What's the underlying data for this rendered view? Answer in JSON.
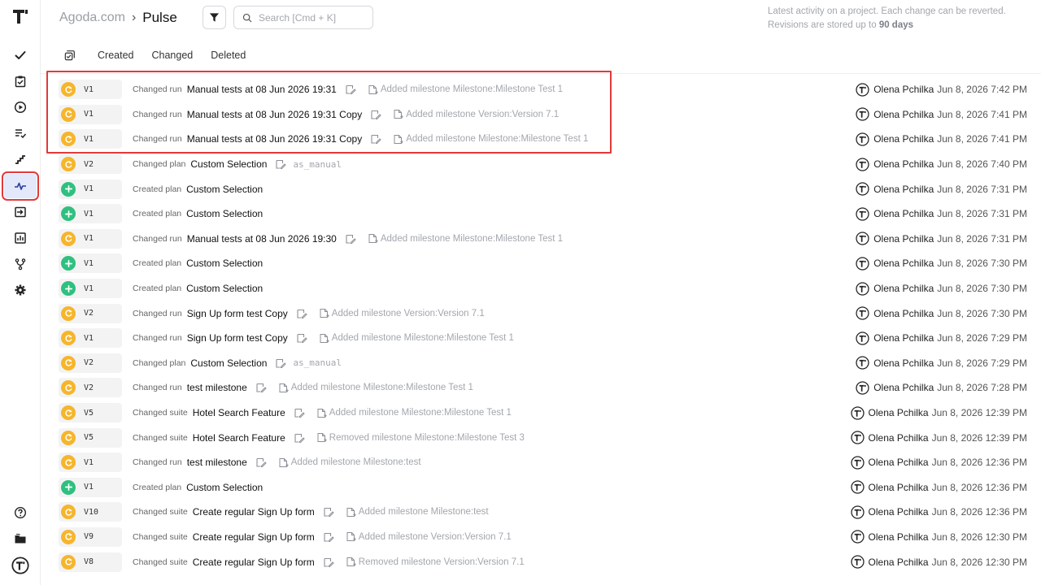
{
  "header": {
    "project": "Agoda.com",
    "separator": "›",
    "page": "Pulse",
    "note_line1": "Latest activity on a project. Each change can be reverted.",
    "note_line2_prefix": "Revisions are stored up to",
    "note_line2_bold": "90 days"
  },
  "search": {
    "placeholder": "Search [Cmd + K]"
  },
  "tabs": [
    {
      "label": "Created"
    },
    {
      "label": "Changed"
    },
    {
      "label": "Deleted"
    }
  ],
  "sidebar": {
    "items": [
      {
        "icon": "check-icon"
      },
      {
        "icon": "clipboard-check-icon"
      },
      {
        "icon": "play-circle-icon"
      },
      {
        "icon": "list-check-icon"
      },
      {
        "icon": "trend-line-icon"
      },
      {
        "icon": "pulse-icon",
        "active": true
      },
      {
        "icon": "import-icon"
      },
      {
        "icon": "bar-chart-icon"
      },
      {
        "icon": "branch-icon"
      },
      {
        "icon": "gear-icon"
      }
    ],
    "bottom": [
      {
        "icon": "help-icon"
      },
      {
        "icon": "folder-icon"
      },
      {
        "icon": "user-avatar-icon"
      }
    ]
  },
  "colors": {
    "changed": "#f6b52b",
    "created": "#2fc07f",
    "highlight": "#e23a3a",
    "active_nav": "#e3e9fb"
  },
  "rows": [
    {
      "status": "changed",
      "version": "V1",
      "action": "Changed run",
      "entity": "Manual tests at 08 Jun 2026 19:31",
      "detail": "Added milestone Milestone:Milestone Test 1",
      "mono": false,
      "author": "Olena Pchilka",
      "time": "Jun 8, 2026 7:42 PM"
    },
    {
      "status": "changed",
      "version": "V1",
      "action": "Changed run",
      "entity": "Manual tests at 08 Jun 2026 19:31 Copy",
      "detail": "Added milestone Version:Version 7.1",
      "mono": false,
      "author": "Olena Pchilka",
      "time": "Jun 8, 2026 7:41 PM"
    },
    {
      "status": "changed",
      "version": "V1",
      "action": "Changed run",
      "entity": "Manual tests at 08 Jun 2026 19:31 Copy",
      "detail": "Added milestone Milestone:Milestone Test 1",
      "mono": false,
      "author": "Olena Pchilka",
      "time": "Jun 8, 2026 7:41 PM"
    },
    {
      "status": "changed",
      "version": "V2",
      "action": "Changed plan",
      "entity": "Custom Selection",
      "detail": "as_manual",
      "mono": true,
      "author": "Olena Pchilka",
      "time": "Jun 8, 2026 7:40 PM"
    },
    {
      "status": "created",
      "version": "V1",
      "action": "Created plan",
      "entity": "Custom Selection",
      "detail": "",
      "mono": false,
      "author": "Olena Pchilka",
      "time": "Jun 8, 2026 7:31 PM"
    },
    {
      "status": "created",
      "version": "V1",
      "action": "Created plan",
      "entity": "Custom Selection",
      "detail": "",
      "mono": false,
      "author": "Olena Pchilka",
      "time": "Jun 8, 2026 7:31 PM"
    },
    {
      "status": "changed",
      "version": "V1",
      "action": "Changed run",
      "entity": "Manual tests at 08 Jun 2026 19:30",
      "detail": "Added milestone Milestone:Milestone Test 1",
      "mono": false,
      "author": "Olena Pchilka",
      "time": "Jun 8, 2026 7:31 PM"
    },
    {
      "status": "created",
      "version": "V1",
      "action": "Created plan",
      "entity": "Custom Selection",
      "detail": "",
      "mono": false,
      "author": "Olena Pchilka",
      "time": "Jun 8, 2026 7:30 PM"
    },
    {
      "status": "created",
      "version": "V1",
      "action": "Created plan",
      "entity": "Custom Selection",
      "detail": "",
      "mono": false,
      "author": "Olena Pchilka",
      "time": "Jun 8, 2026 7:30 PM"
    },
    {
      "status": "changed",
      "version": "V2",
      "action": "Changed run",
      "entity": "Sign Up form test Copy",
      "detail": "Added milestone Version:Version 7.1",
      "mono": false,
      "author": "Olena Pchilka",
      "time": "Jun 8, 2026 7:30 PM"
    },
    {
      "status": "changed",
      "version": "V1",
      "action": "Changed run",
      "entity": "Sign Up form test Copy",
      "detail": "Added milestone Milestone:Milestone Test 1",
      "mono": false,
      "author": "Olena Pchilka",
      "time": "Jun 8, 2026 7:29 PM"
    },
    {
      "status": "changed",
      "version": "V2",
      "action": "Changed plan",
      "entity": "Custom Selection",
      "detail": "as_manual",
      "mono": true,
      "author": "Olena Pchilka",
      "time": "Jun 8, 2026 7:29 PM"
    },
    {
      "status": "changed",
      "version": "V2",
      "action": "Changed run",
      "entity": "test milestone",
      "detail": "Added milestone Milestone:Milestone Test 1",
      "mono": false,
      "author": "Olena Pchilka",
      "time": "Jun 8, 2026 7:28 PM"
    },
    {
      "status": "changed",
      "version": "V5",
      "action": "Changed suite",
      "entity": "Hotel Search Feature",
      "detail": "Added milestone Milestone:Milestone Test 1",
      "mono": false,
      "author": "Olena Pchilka",
      "time": "Jun 8, 2026 12:39 PM"
    },
    {
      "status": "changed",
      "version": "V5",
      "action": "Changed suite",
      "entity": "Hotel Search Feature",
      "detail": "Removed milestone Milestone:Milestone Test 3",
      "mono": false,
      "author": "Olena Pchilka",
      "time": "Jun 8, 2026 12:39 PM"
    },
    {
      "status": "changed",
      "version": "V1",
      "action": "Changed run",
      "entity": "test milestone",
      "detail": "Added milestone Milestone:test",
      "mono": false,
      "author": "Olena Pchilka",
      "time": "Jun 8, 2026 12:36 PM"
    },
    {
      "status": "created",
      "version": "V1",
      "action": "Created plan",
      "entity": "Custom Selection",
      "detail": "",
      "mono": false,
      "author": "Olena Pchilka",
      "time": "Jun 8, 2026 12:36 PM"
    },
    {
      "status": "changed",
      "version": "V10",
      "action": "Changed suite",
      "entity": "Create regular Sign Up form",
      "detail": "Added milestone Milestone:test",
      "mono": false,
      "author": "Olena Pchilka",
      "time": "Jun 8, 2026 12:36 PM"
    },
    {
      "status": "changed",
      "version": "V9",
      "action": "Changed suite",
      "entity": "Create regular Sign Up form",
      "detail": "Added milestone Version:Version 7.1",
      "mono": false,
      "author": "Olena Pchilka",
      "time": "Jun 8, 2026 12:30 PM"
    },
    {
      "status": "changed",
      "version": "V8",
      "action": "Changed suite",
      "entity": "Create regular Sign Up form",
      "detail": "Removed milestone Version:Version 7.1",
      "mono": false,
      "author": "Olena Pchilka",
      "time": "Jun 8, 2026 12:30 PM"
    }
  ]
}
